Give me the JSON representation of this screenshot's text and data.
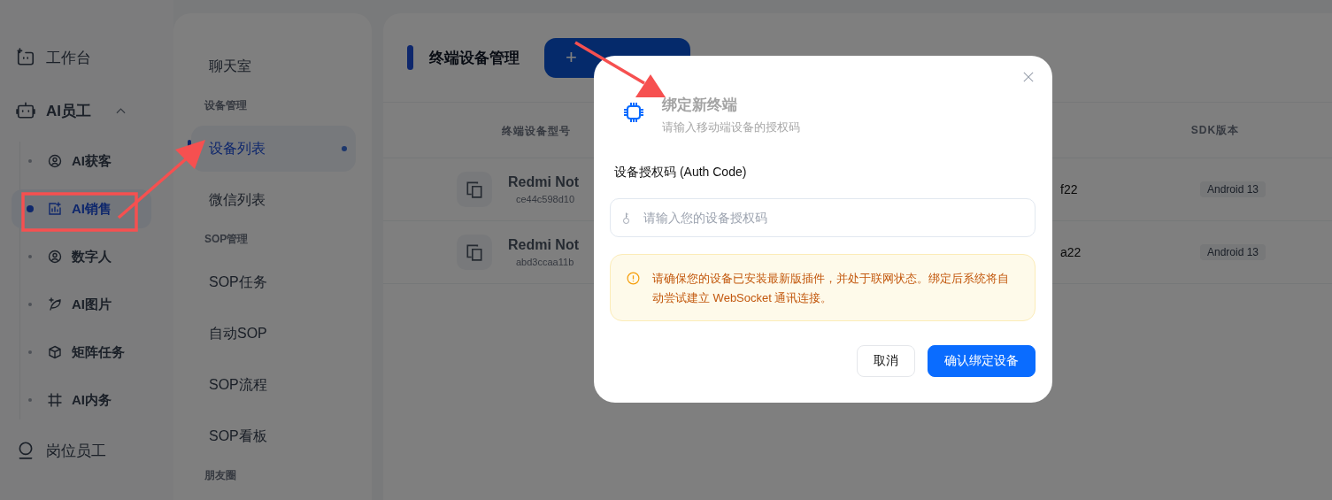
{
  "nav": {
    "items": [
      {
        "label": "工作台"
      },
      {
        "label": "AI员工",
        "expanded": true,
        "children": [
          {
            "label": "AI获客",
            "selected": false
          },
          {
            "label": "AI销售",
            "selected": true
          },
          {
            "label": "数字人",
            "selected": false
          },
          {
            "label": "AI图片",
            "selected": false
          },
          {
            "label": "矩阵任务",
            "selected": false
          },
          {
            "label": "AI内务",
            "selected": false
          }
        ]
      },
      {
        "label": "岗位员工"
      }
    ]
  },
  "submenu": {
    "items": [
      {
        "kind": "item",
        "label": "聊天室",
        "selected": false
      },
      {
        "kind": "section",
        "label": "设备管理"
      },
      {
        "kind": "item",
        "label": "设备列表",
        "selected": true
      },
      {
        "kind": "item",
        "label": "微信列表",
        "selected": false
      },
      {
        "kind": "section",
        "label": "SOP管理"
      },
      {
        "kind": "item",
        "label": "SOP任务",
        "selected": false
      },
      {
        "kind": "item",
        "label": "自动SOP",
        "selected": false
      },
      {
        "kind": "item",
        "label": "SOP流程",
        "selected": false
      },
      {
        "kind": "item",
        "label": "SOP看板",
        "selected": false
      },
      {
        "kind": "section",
        "label": "朋友圈"
      }
    ]
  },
  "main": {
    "title": "终端设备管理",
    "add_button": "+",
    "table": {
      "columns": [
        "终端设备型号",
        "SDK版本"
      ],
      "rows": [
        {
          "name": "Redmi Not",
          "id": "ce44c598d10",
          "column_2": "f22",
          "sdk": "Android 13"
        },
        {
          "name": "Redmi Not",
          "id": "abd3ccaa11b",
          "column_2": "a22",
          "sdk": "Android 13"
        }
      ]
    }
  },
  "dialog": {
    "title": "绑定新终端",
    "subtitle": "请输入移动端设备的授权码",
    "field_label": "设备授权码 (Auth Code)",
    "placeholder": "请输入您的设备授权码",
    "notice": "请确保您的设备已安装最新版插件，并处于联网状态。绑定后系统将自动尝试建立 WebSocket 通讯连接。",
    "buttons": [
      {
        "kind": "secondary",
        "label": "取消"
      },
      {
        "kind": "primary",
        "label": "确认绑定设备"
      }
    ]
  }
}
